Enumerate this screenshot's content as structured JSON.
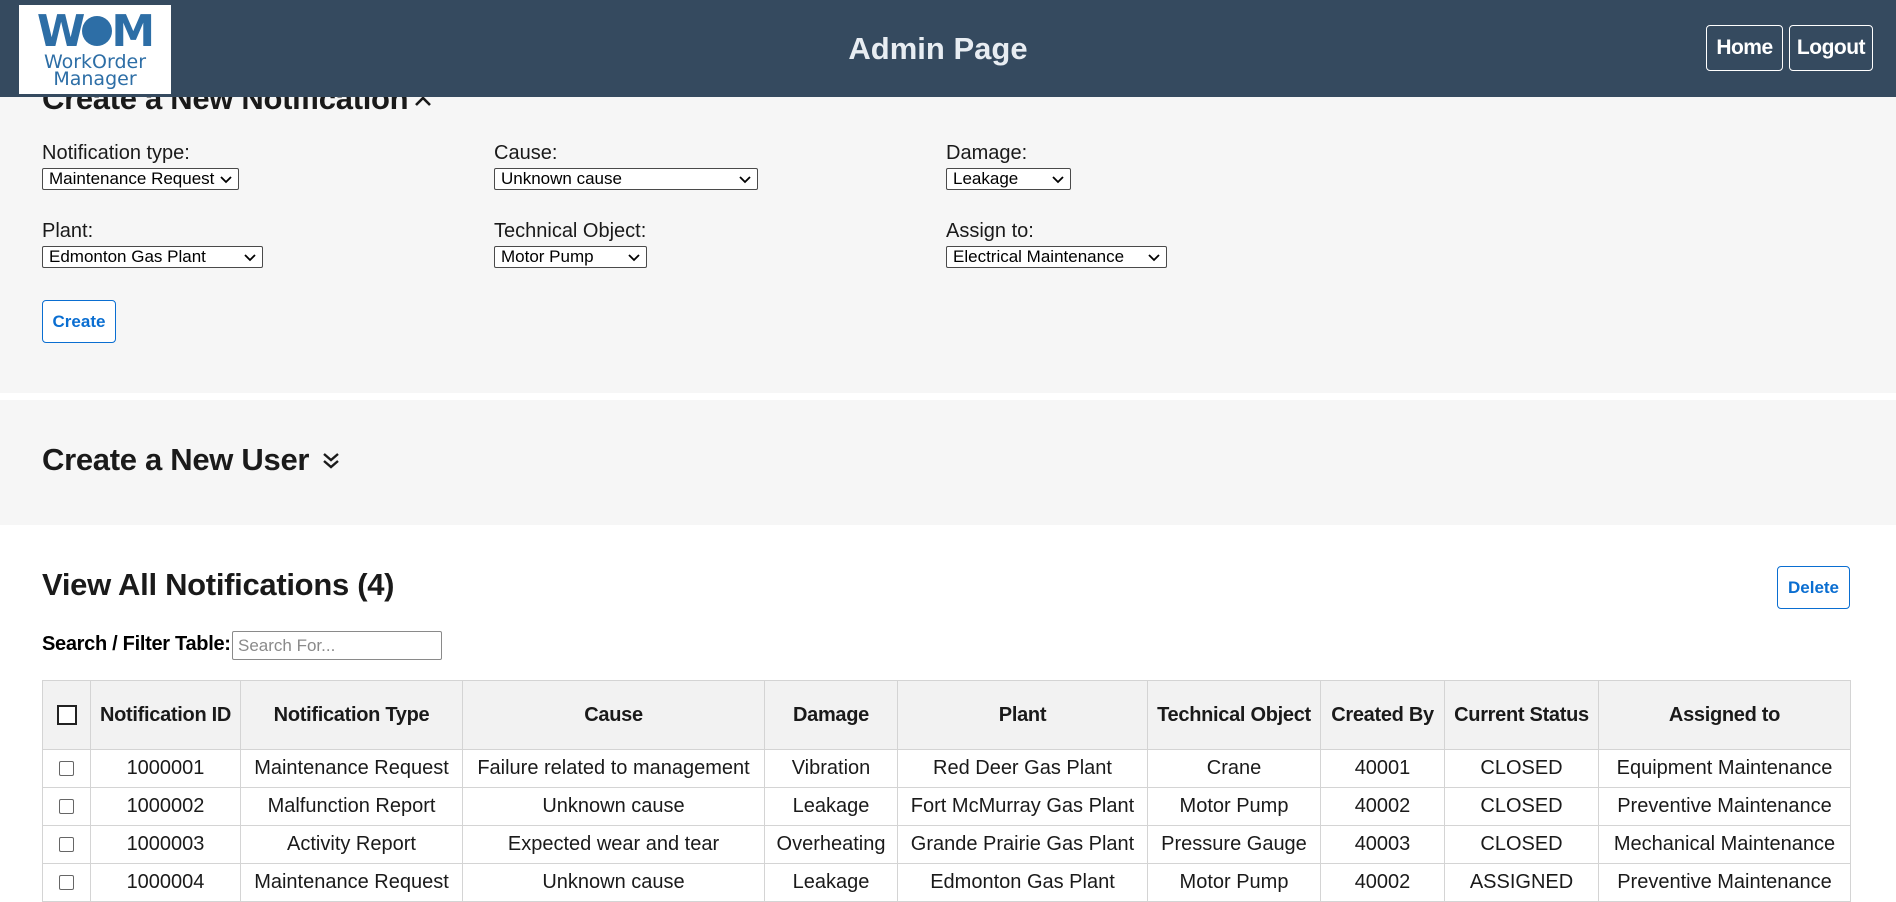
{
  "header": {
    "logo": {
      "mark": "WOM",
      "line1": "WorkOrder",
      "line2": "Manager"
    },
    "title": "Admin Page",
    "home_label": "Home",
    "logout_label": "Logout"
  },
  "create_notification": {
    "title": "Create a New Notification",
    "toggle_icon": "chevron-up-icon",
    "fields": {
      "notification_type": {
        "label": "Notification type:",
        "value": "Maintenance Request"
      },
      "cause": {
        "label": "Cause:",
        "value": "Unknown cause"
      },
      "damage": {
        "label": "Damage:",
        "value": "Leakage"
      },
      "plant": {
        "label": "Plant:",
        "value": "Edmonton Gas Plant"
      },
      "technical_object": {
        "label": "Technical Object:",
        "value": "Motor Pump"
      },
      "assign_to": {
        "label": "Assign to:",
        "value": "Electrical Maintenance"
      }
    },
    "create_label": "Create"
  },
  "create_user": {
    "title": "Create a New User",
    "toggle_icon": "double-chevron-down-icon"
  },
  "notifications": {
    "title": "View All Notifications (4)",
    "delete_label": "Delete",
    "search_label": "Search / Filter Table:",
    "search_placeholder": "Search For...",
    "search_value": "",
    "columns": [
      "Notification ID",
      "Notification Type",
      "Cause",
      "Damage",
      "Plant",
      "Technical Object",
      "Created By",
      "Current Status",
      "Assigned to"
    ],
    "rows": [
      [
        "1000001",
        "Maintenance Request",
        "Failure related to management",
        "Vibration",
        "Red Deer Gas Plant",
        "Crane",
        "40001",
        "CLOSED",
        "Equipment Maintenance"
      ],
      [
        "1000002",
        "Malfunction Report",
        "Unknown cause",
        "Leakage",
        "Fort McMurray Gas Plant",
        "Motor Pump",
        "40002",
        "CLOSED",
        "Preventive Maintenance"
      ],
      [
        "1000003",
        "Activity Report",
        "Expected wear and tear",
        "Overheating",
        "Grande Prairie Gas Plant",
        "Pressure Gauge",
        "40003",
        "CLOSED",
        "Mechanical Maintenance"
      ],
      [
        "1000004",
        "Maintenance Request",
        "Unknown cause",
        "Leakage",
        "Edmonton Gas Plant",
        "Motor Pump",
        "40002",
        "ASSIGNED",
        "Preventive Maintenance"
      ]
    ]
  }
}
